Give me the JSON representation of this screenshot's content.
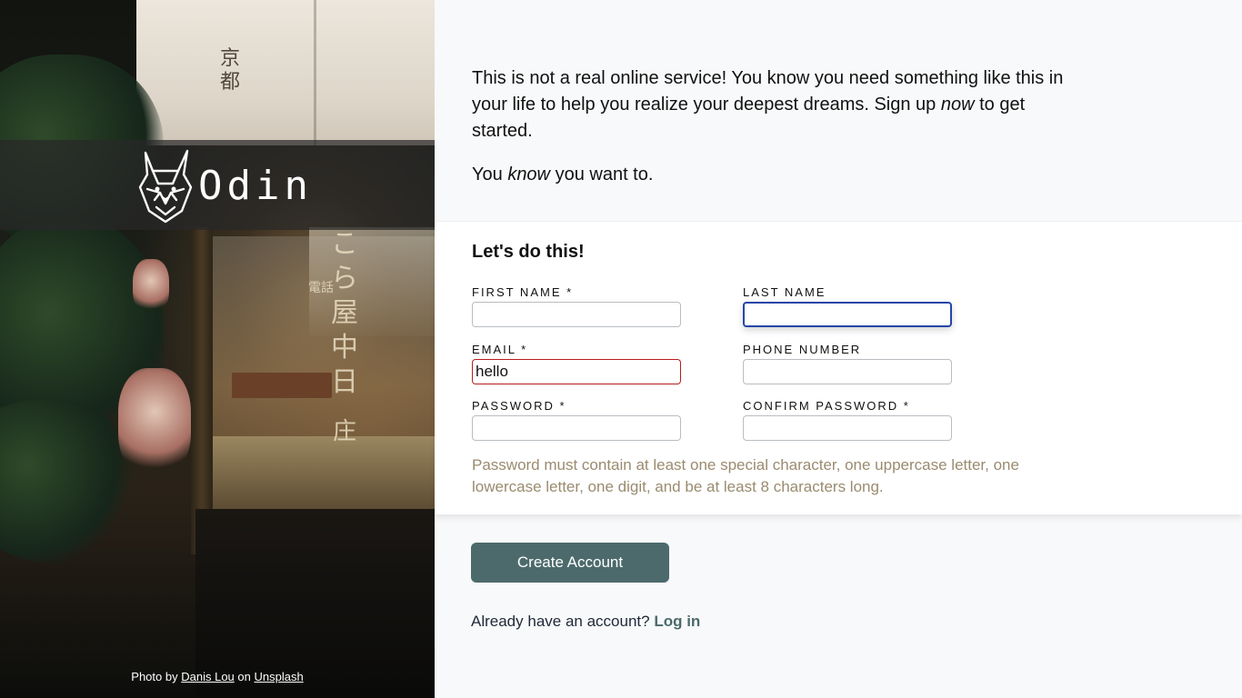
{
  "brand": {
    "logo_text": "Odin",
    "logo_icon": "odin-dog-head-logo"
  },
  "intro": {
    "paragraph1_part1": "This is not a real online service! You know you need something like this in your life to help you realize your deepest dreams. Sign up ",
    "paragraph1_emph": "now",
    "paragraph1_part2": " to get started.",
    "paragraph2_part1": "You ",
    "paragraph2_emph": "know",
    "paragraph2_part2": " you want to."
  },
  "form": {
    "title": "Let's do this!",
    "fields": {
      "first_name": {
        "label": "FIRST NAME *",
        "value": ""
      },
      "last_name": {
        "label": "LAST NAME",
        "value": ""
      },
      "email": {
        "label": "EMAIL *",
        "value": "hello"
      },
      "phone": {
        "label": "PHONE NUMBER",
        "value": ""
      },
      "password": {
        "label": "PASSWORD *",
        "value": ""
      },
      "confirm_password": {
        "label": "CONFIRM PASSWORD *",
        "value": ""
      }
    },
    "hint": "Password must contain at least one special character, one uppercase letter, one lowercase letter, one digit, and be at least 8 characters long."
  },
  "actions": {
    "create_label": "Create Account",
    "login_prompt": "Already have an account?",
    "login_link": "Log in"
  },
  "credit": {
    "prefix": "Photo by",
    "author": "Danis Lou",
    "middle": "on",
    "site": "Unsplash"
  },
  "photo_signage": {
    "col1": "京都",
    "col2": "こら屋中日",
    "col3": "電話",
    "col4": "庄"
  },
  "colors": {
    "button": "#4c6a6c",
    "invalid_border": "#b91c1c",
    "focus_border": "#2546a8",
    "hint_text": "#9a8b6f"
  }
}
